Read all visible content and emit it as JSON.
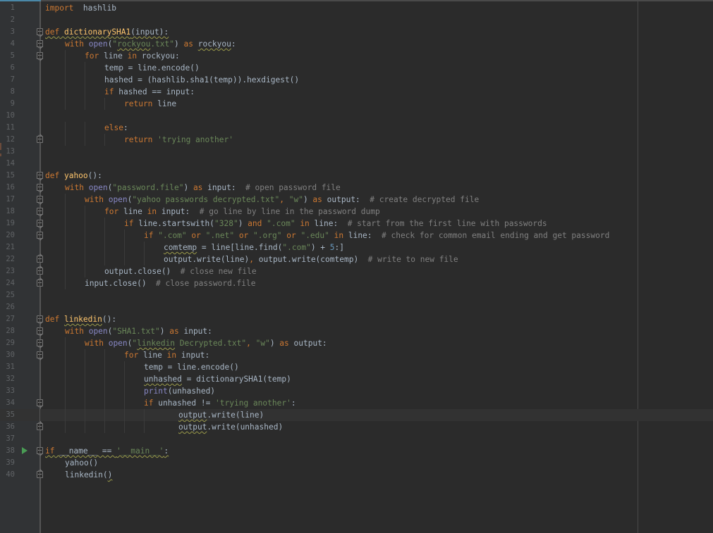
{
  "editor": {
    "language": "python",
    "current_line": 35,
    "lines": [
      {
        "n": "1",
        "tokens": [
          [
            "kw",
            "import"
          ],
          [
            "",
            "  hashlib"
          ]
        ]
      },
      {
        "n": "2",
        "tokens": []
      },
      {
        "n": "3",
        "fold": "open",
        "tokens": [
          [
            "kw sq",
            "def"
          ],
          [
            "sq",
            " "
          ],
          [
            "fn sq",
            "dictionarySHA1"
          ],
          [
            "sq",
            "(input):"
          ]
        ]
      },
      {
        "n": "4",
        "fold": "open",
        "indent": 1,
        "tokens": [
          [
            "kw",
            "with"
          ],
          [
            "",
            " "
          ],
          [
            "bi",
            "open"
          ],
          [
            "",
            "("
          ],
          [
            "str",
            "\""
          ],
          [
            "str sq",
            "rockyou"
          ],
          [
            "str",
            ".txt\""
          ],
          [
            "",
            ") "
          ],
          [
            "kw",
            "as"
          ],
          [
            "",
            " "
          ],
          [
            "sq",
            "rockyou"
          ],
          [
            "",
            ":"
          ]
        ]
      },
      {
        "n": "5",
        "fold": "open",
        "indent": 2,
        "tokens": [
          [
            "kw",
            "for"
          ],
          [
            "",
            " line "
          ],
          [
            "kw",
            "in"
          ],
          [
            "",
            " rockyou:"
          ]
        ]
      },
      {
        "n": "6",
        "indent": 3,
        "tokens": [
          [
            "",
            "temp = line.encode()"
          ]
        ]
      },
      {
        "n": "7",
        "indent": 3,
        "tokens": [
          [
            "",
            "hashed = (hashlib.sha1(temp)).hexdigest()"
          ]
        ]
      },
      {
        "n": "8",
        "indent": 3,
        "tokens": [
          [
            "kw",
            "if"
          ],
          [
            "",
            " hashed == input:"
          ]
        ]
      },
      {
        "n": "9",
        "indent": 4,
        "tokens": [
          [
            "kw",
            "return"
          ],
          [
            "",
            " line"
          ]
        ]
      },
      {
        "n": "10",
        "tokens": []
      },
      {
        "n": "11",
        "indent": 3,
        "tokens": [
          [
            "kw",
            "else"
          ],
          [
            "",
            ":"
          ]
        ]
      },
      {
        "n": "12",
        "fold": "close",
        "indent": 4,
        "tokens": [
          [
            "kw",
            "return"
          ],
          [
            "",
            " "
          ],
          [
            "str",
            "'trying another'"
          ]
        ]
      },
      {
        "n": "13",
        "tokens": []
      },
      {
        "n": "14",
        "tokens": []
      },
      {
        "n": "15",
        "fold": "open",
        "tokens": [
          [
            "kw",
            "def"
          ],
          [
            "",
            " "
          ],
          [
            "fn",
            "yahoo"
          ],
          [
            "",
            "():"
          ]
        ]
      },
      {
        "n": "16",
        "fold": "open",
        "indent": 1,
        "tokens": [
          [
            "kw",
            "with"
          ],
          [
            "",
            " "
          ],
          [
            "bi",
            "open"
          ],
          [
            "",
            "("
          ],
          [
            "str",
            "\"password.file\""
          ],
          [
            "",
            ") "
          ],
          [
            "kw",
            "as"
          ],
          [
            "",
            " input:  "
          ],
          [
            "cm",
            "# open password file"
          ]
        ]
      },
      {
        "n": "17",
        "fold": "open",
        "indent": 2,
        "tokens": [
          [
            "kw",
            "with"
          ],
          [
            "",
            " "
          ],
          [
            "bi",
            "open"
          ],
          [
            "",
            "("
          ],
          [
            "str",
            "\"yahoo passwords decrypted.txt\""
          ],
          [
            "kw",
            ","
          ],
          [
            "",
            " "
          ],
          [
            "str",
            "\"w\""
          ],
          [
            "",
            ") "
          ],
          [
            "kw",
            "as"
          ],
          [
            "",
            " output:  "
          ],
          [
            "cm",
            "# create decrypted file"
          ]
        ]
      },
      {
        "n": "18",
        "fold": "open",
        "indent": 3,
        "tokens": [
          [
            "kw",
            "for"
          ],
          [
            "",
            " line "
          ],
          [
            "kw",
            "in"
          ],
          [
            "",
            " input:  "
          ],
          [
            "cm",
            "# go line by line in the password dump"
          ]
        ]
      },
      {
        "n": "19",
        "fold": "open",
        "indent": 4,
        "tokens": [
          [
            "kw",
            "if"
          ],
          [
            "",
            " line.startswith("
          ],
          [
            "str",
            "\"328\""
          ],
          [
            "",
            ") "
          ],
          [
            "kw",
            "and"
          ],
          [
            "",
            " "
          ],
          [
            "str",
            "\".com\""
          ],
          [
            "",
            " "
          ],
          [
            "kw",
            "in"
          ],
          [
            "",
            " line:  "
          ],
          [
            "cm",
            "# start from the first line with passwords"
          ]
        ]
      },
      {
        "n": "20",
        "fold": "open",
        "indent": 5,
        "tokens": [
          [
            "kw",
            "if"
          ],
          [
            "",
            " "
          ],
          [
            "str",
            "\".com\""
          ],
          [
            "",
            " "
          ],
          [
            "kw",
            "or"
          ],
          [
            "",
            " "
          ],
          [
            "str",
            "\".net\""
          ],
          [
            "",
            " "
          ],
          [
            "kw",
            "or"
          ],
          [
            "",
            " "
          ],
          [
            "str",
            "\".org\""
          ],
          [
            "",
            " "
          ],
          [
            "kw",
            "or"
          ],
          [
            "",
            " "
          ],
          [
            "str",
            "\".edu\""
          ],
          [
            "",
            " "
          ],
          [
            "kw",
            "in"
          ],
          [
            "",
            " line:  "
          ],
          [
            "cm",
            "# check for common email ending and get password"
          ]
        ]
      },
      {
        "n": "21",
        "indent": 6,
        "tokens": [
          [
            "sq",
            "comtemp"
          ],
          [
            "",
            " = line[line.find("
          ],
          [
            "str",
            "\".com\""
          ],
          [
            "",
            ") + "
          ],
          [
            "num",
            "5"
          ],
          [
            "",
            ":]"
          ]
        ]
      },
      {
        "n": "22",
        "fold": "close",
        "indent": 6,
        "tokens": [
          [
            "",
            "output.write(line)"
          ],
          [
            "kw",
            ","
          ],
          [
            "",
            " output.write(comtemp)  "
          ],
          [
            "cm",
            "# write to new file"
          ]
        ]
      },
      {
        "n": "23",
        "fold": "close",
        "indent": 3,
        "tokens": [
          [
            "",
            "output.close()  "
          ],
          [
            "cm",
            "# close new file"
          ]
        ]
      },
      {
        "n": "24",
        "fold": "close",
        "indent": 2,
        "tokens": [
          [
            "",
            "input.close()  "
          ],
          [
            "cm",
            "# close password.file"
          ]
        ]
      },
      {
        "n": "25",
        "tokens": []
      },
      {
        "n": "26",
        "tokens": []
      },
      {
        "n": "27",
        "fold": "open",
        "tokens": [
          [
            "kw",
            "def"
          ],
          [
            "",
            " "
          ],
          [
            "fn sq",
            "linkedin"
          ],
          [
            "",
            "():"
          ]
        ]
      },
      {
        "n": "28",
        "fold": "open",
        "indent": 1,
        "tokens": [
          [
            "kw",
            "with"
          ],
          [
            "",
            " "
          ],
          [
            "bi",
            "open"
          ],
          [
            "",
            "("
          ],
          [
            "str",
            "\"SHA1.txt\""
          ],
          [
            "",
            ") "
          ],
          [
            "kw",
            "as"
          ],
          [
            "",
            " input:"
          ]
        ]
      },
      {
        "n": "29",
        "fold": "open",
        "indent": 2,
        "tokens": [
          [
            "kw",
            "with"
          ],
          [
            "",
            " "
          ],
          [
            "bi",
            "open"
          ],
          [
            "",
            "("
          ],
          [
            "str",
            "\""
          ],
          [
            "str sq",
            "linkedin"
          ],
          [
            "str",
            " Decrypted.txt\""
          ],
          [
            "kw",
            ","
          ],
          [
            "",
            " "
          ],
          [
            "str",
            "\"w\""
          ],
          [
            "",
            ") "
          ],
          [
            "kw",
            "as"
          ],
          [
            "",
            " output:"
          ]
        ]
      },
      {
        "n": "30",
        "fold": "open",
        "indent": 4,
        "tokens": [
          [
            "kw",
            "for"
          ],
          [
            "",
            " line "
          ],
          [
            "kw",
            "in"
          ],
          [
            "",
            " input:"
          ]
        ]
      },
      {
        "n": "31",
        "indent": 5,
        "tokens": [
          [
            "",
            "temp = line.encode()"
          ]
        ]
      },
      {
        "n": "32",
        "indent": 5,
        "tokens": [
          [
            "sq",
            "unhashed"
          ],
          [
            "",
            " = dictionarySHA1(temp)"
          ]
        ]
      },
      {
        "n": "33",
        "indent": 5,
        "tokens": [
          [
            "bi",
            "print"
          ],
          [
            "",
            "(unhashed)"
          ]
        ]
      },
      {
        "n": "34",
        "fold": "open",
        "indent": 5,
        "tokens": [
          [
            "kw",
            "if"
          ],
          [
            "",
            " unhashed != "
          ],
          [
            "str",
            "'trying another'"
          ],
          [
            "",
            ":"
          ]
        ]
      },
      {
        "n": "35",
        "indent": 6.75,
        "tokens": [
          [
            "sq",
            "output"
          ],
          [
            "",
            ".write(line)"
          ]
        ]
      },
      {
        "n": "36",
        "fold": "close",
        "indent": 6.75,
        "tokens": [
          [
            "sq",
            "output"
          ],
          [
            "",
            ".write(unhashed)"
          ]
        ]
      },
      {
        "n": "37",
        "tokens": []
      },
      {
        "n": "38",
        "fold": "open",
        "run": true,
        "tokens": [
          [
            "kw sq",
            "if"
          ],
          [
            "sq",
            " __name__ == "
          ],
          [
            "str sq",
            "'__main__'"
          ],
          [
            "sq",
            ":"
          ]
        ]
      },
      {
        "n": "39",
        "indent": 1,
        "tokens": [
          [
            "",
            "yahoo()"
          ]
        ]
      },
      {
        "n": "40",
        "fold": "close",
        "indent": 1,
        "tokens": [
          [
            "",
            "linkedin("
          ],
          [
            "sq",
            ")"
          ]
        ]
      }
    ],
    "icons": {
      "run": "run-triangle-icon",
      "fold_open": "fold-open-icon",
      "fold_close": "fold-close-icon"
    }
  }
}
